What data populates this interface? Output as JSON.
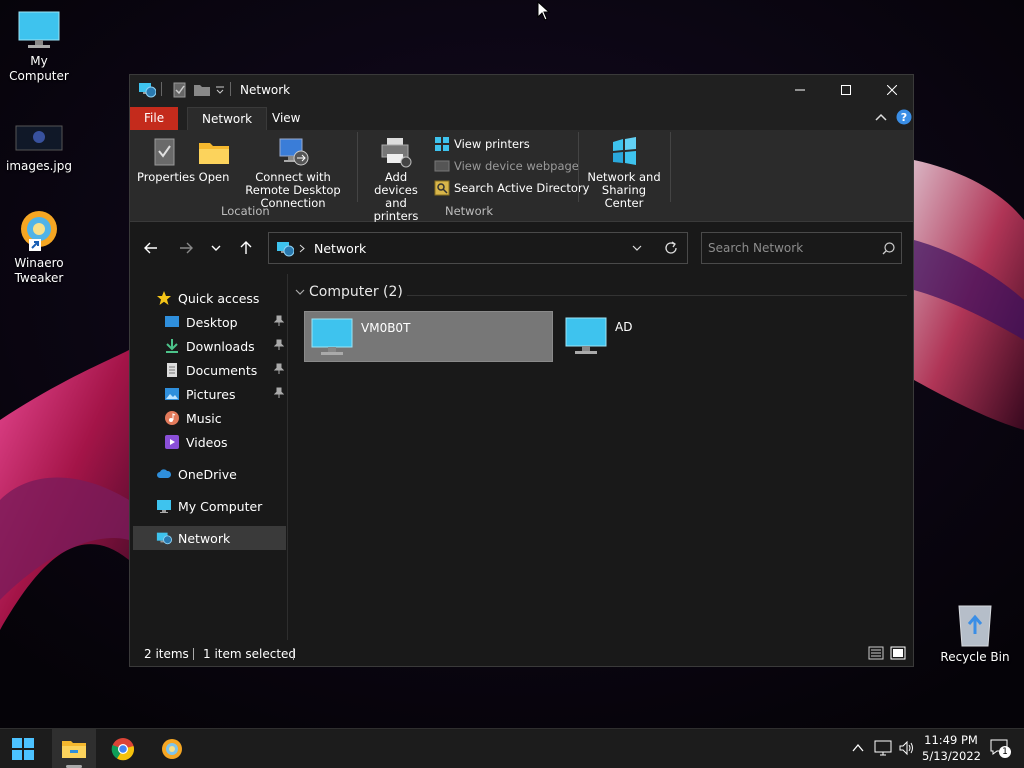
{
  "desktop": {
    "icons": [
      {
        "label": "My Computer"
      },
      {
        "label": "images.jpg"
      },
      {
        "label": "Winaero Tweaker"
      },
      {
        "label": "Recycle Bin"
      }
    ]
  },
  "window": {
    "title": "Network",
    "ribbon_tabs": {
      "file": "File",
      "network": "Network",
      "view": "View"
    },
    "ribbon": {
      "properties": "Properties",
      "open": "Open",
      "connect_rdp": "Connect with Remote Desktop Connection",
      "location_group": "Location",
      "add_devices": "Add devices and printers",
      "view_printers": "View printers",
      "view_device_webpage": "View device webpage",
      "search_ad": "Search Active Directory",
      "network_group": "Network",
      "network_sharing": "Network and Sharing Center"
    },
    "address": {
      "path": "Network"
    },
    "search": {
      "placeholder": "Search Network"
    },
    "nav_pane": {
      "quick_access": "Quick access",
      "desktop": "Desktop",
      "downloads": "Downloads",
      "documents": "Documents",
      "pictures": "Pictures",
      "music": "Music",
      "videos": "Videos",
      "onedrive": "OneDrive",
      "my_computer": "My Computer",
      "network": "Network"
    },
    "content": {
      "group_header": "Computer (2)",
      "items": [
        {
          "name": "VM0B0T",
          "selected": true
        },
        {
          "name": "AD",
          "selected": false
        }
      ]
    },
    "status": {
      "items": "2 items",
      "selected": "1 item selected"
    }
  },
  "taskbar": {
    "time": "11:49 PM",
    "date": "5/13/2022",
    "notification_count": "1"
  },
  "colors": {
    "file_tab": "#c42b1c",
    "accent": "#3a8ee6"
  }
}
